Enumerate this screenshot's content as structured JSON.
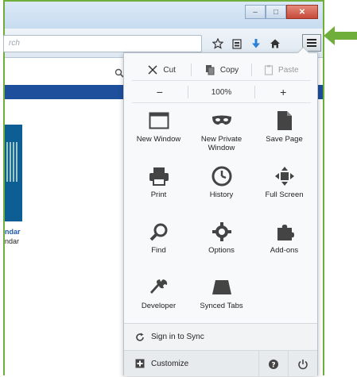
{
  "browser": {
    "url_placeholder": "rch",
    "window_buttons": {
      "minimize": "–",
      "maximize": "□",
      "close": "✕"
    }
  },
  "page": {
    "thumb_label_1": "ndar",
    "thumb_label_2": "ndar"
  },
  "menu": {
    "edit": {
      "cut": "Cut",
      "copy": "Copy",
      "paste": "Paste"
    },
    "zoom": {
      "minus": "−",
      "level": "100%",
      "plus": "+"
    },
    "items": [
      {
        "label": "New Window",
        "icon": "window-icon"
      },
      {
        "label": "New Private Window",
        "icon": "mask-icon"
      },
      {
        "label": "Save Page",
        "icon": "page-icon"
      },
      {
        "label": "Print",
        "icon": "printer-icon"
      },
      {
        "label": "History",
        "icon": "clock-icon"
      },
      {
        "label": "Full Screen",
        "icon": "fullscreen-icon"
      },
      {
        "label": "Find",
        "icon": "magnifier-icon"
      },
      {
        "label": "Options",
        "icon": "gear-icon"
      },
      {
        "label": "Add-ons",
        "icon": "puzzle-icon"
      },
      {
        "label": "Developer",
        "icon": "wrench-icon"
      },
      {
        "label": "Synced Tabs",
        "icon": "synced-tabs-icon"
      }
    ],
    "sync_label": "Sign in to Sync",
    "customize_label": "Customize"
  },
  "colors": {
    "highlight_green": "#6fae3a",
    "page_blue_bar": "#1e4f9c"
  }
}
